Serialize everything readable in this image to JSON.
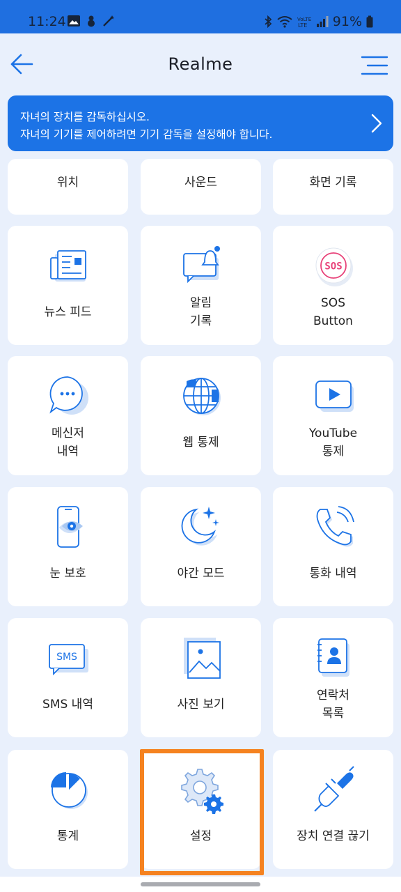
{
  "status": {
    "time": "11:24",
    "battery": "91%"
  },
  "header": {
    "title": "Realme"
  },
  "banner": {
    "line1": "자녀의 장치를 감독하십시오.",
    "line2": "자녀의 기기를 제어하려면 기기 감독을 설정해야 합니다."
  },
  "features": {
    "location": "위치",
    "sound": "사운드",
    "screen_record": "화면 기록",
    "news_feed": "뉴스 피드",
    "notif_1": "알림",
    "notif_2": "기록",
    "sos_1": "SOS",
    "sos_2": "Button",
    "sos_badge": "SOS",
    "messenger_1": "메신저",
    "messenger_2": "내역",
    "web_control": "웹 통제",
    "youtube_1": "YouTube",
    "youtube_2": "통제",
    "eye_protect": "눈 보호",
    "night_mode": "야간 모드",
    "call_history": "통화 내역",
    "sms_history": "SMS 내역",
    "sms_badge": "SMS",
    "photo_view": "사진 보기",
    "contacts_1": "연락처",
    "contacts_2": "목록",
    "statistics": "통계",
    "settings": "설정",
    "disconnect": "장치 연결 끊기"
  },
  "colors": {
    "accent": "#1c73e6",
    "statusbar": "#1f6fe0",
    "background": "#e9f0fc",
    "highlight": "#f58220",
    "icon_light": "#cfe0f8",
    "sos_pink": "#e8437a"
  }
}
